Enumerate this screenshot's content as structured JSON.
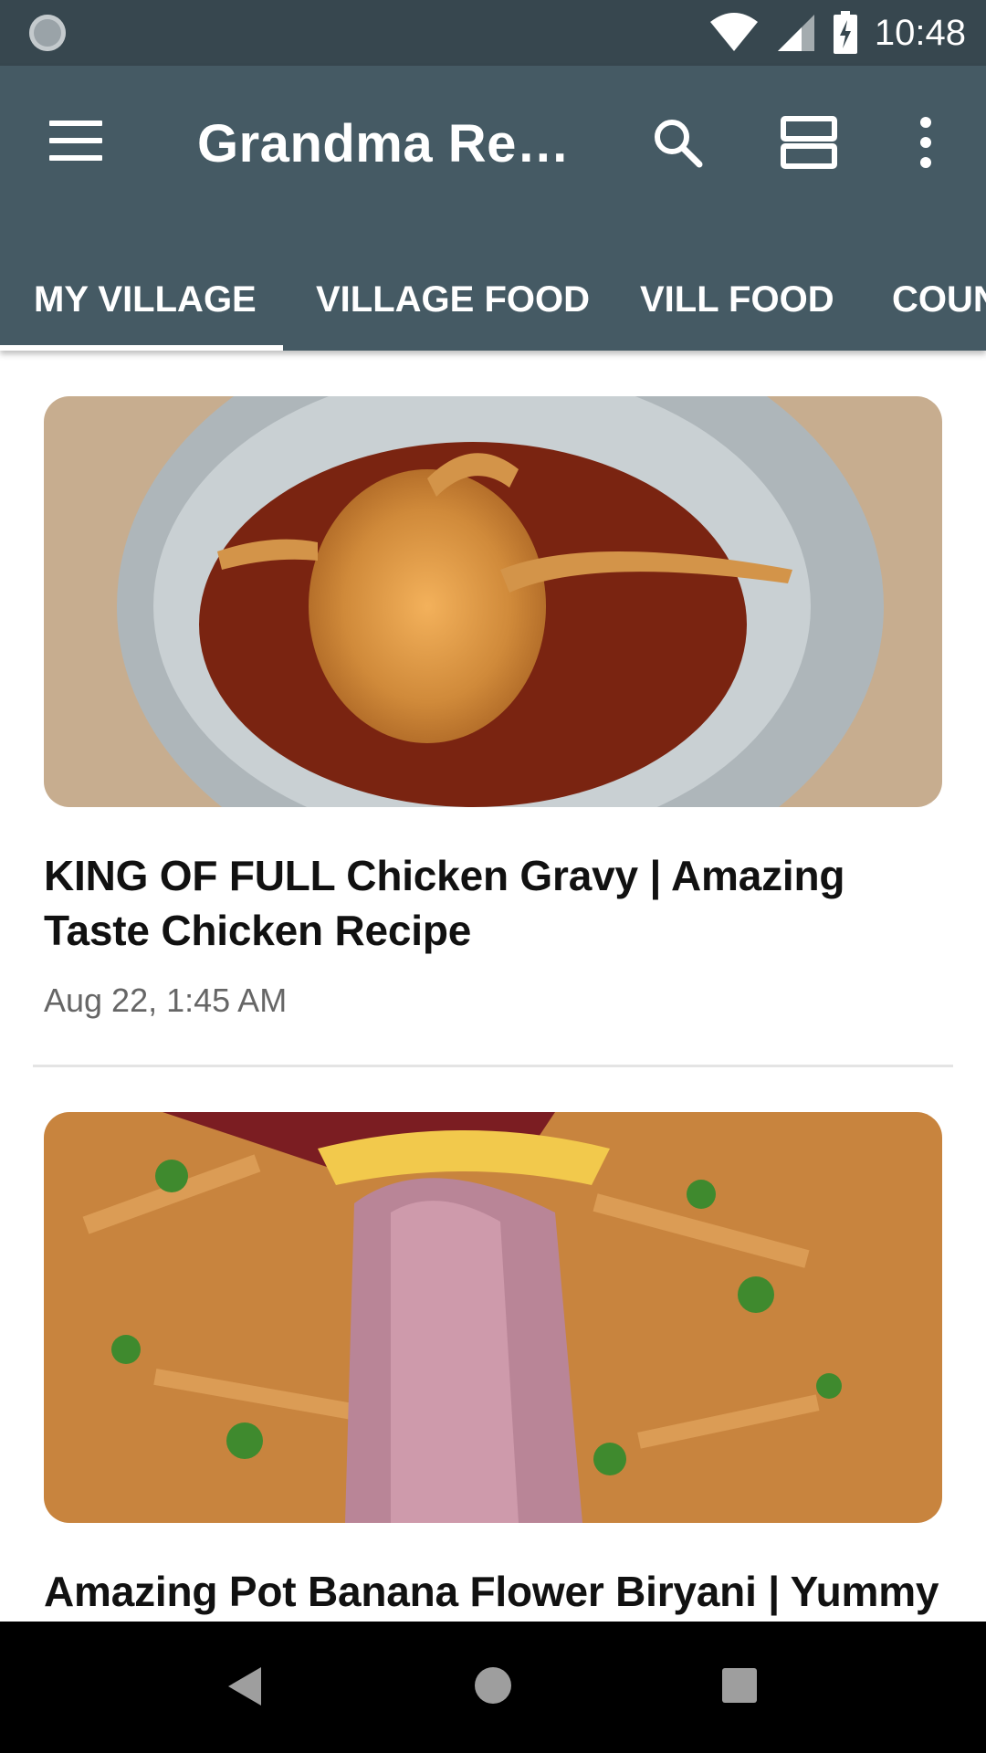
{
  "status_bar": {
    "time": "10:48",
    "icons": [
      "sync-icon",
      "wifi-icon",
      "cell-signal-icon",
      "battery-charging-icon"
    ]
  },
  "app_bar": {
    "title": "Grandma Reci...",
    "icons": [
      "menu-icon",
      "search-icon",
      "view-toggle-icon",
      "more-vert-icon"
    ]
  },
  "tabs": [
    {
      "label": "MY VILLAGE",
      "selected": true
    },
    {
      "label": "VILLAGE FOOD",
      "selected": false
    },
    {
      "label": "VILL FOOD",
      "selected": false
    },
    {
      "label": "COUN",
      "selected": false
    }
  ],
  "feed": {
    "items": [
      {
        "title": "KING OF FULL Chicken Gravy | Amazing Taste Chicken Recipe",
        "time": "Aug 22, 1:45 AM"
      },
      {
        "title": "Amazing Pot Banana Flower Biryani | Yummy"
      }
    ]
  },
  "nav_bar": {
    "buttons": [
      "back-icon",
      "home-icon",
      "recents-icon"
    ]
  },
  "colors": {
    "status_bar": "#37474f",
    "app_bar": "#455a64",
    "nav_bar": "#000000"
  }
}
